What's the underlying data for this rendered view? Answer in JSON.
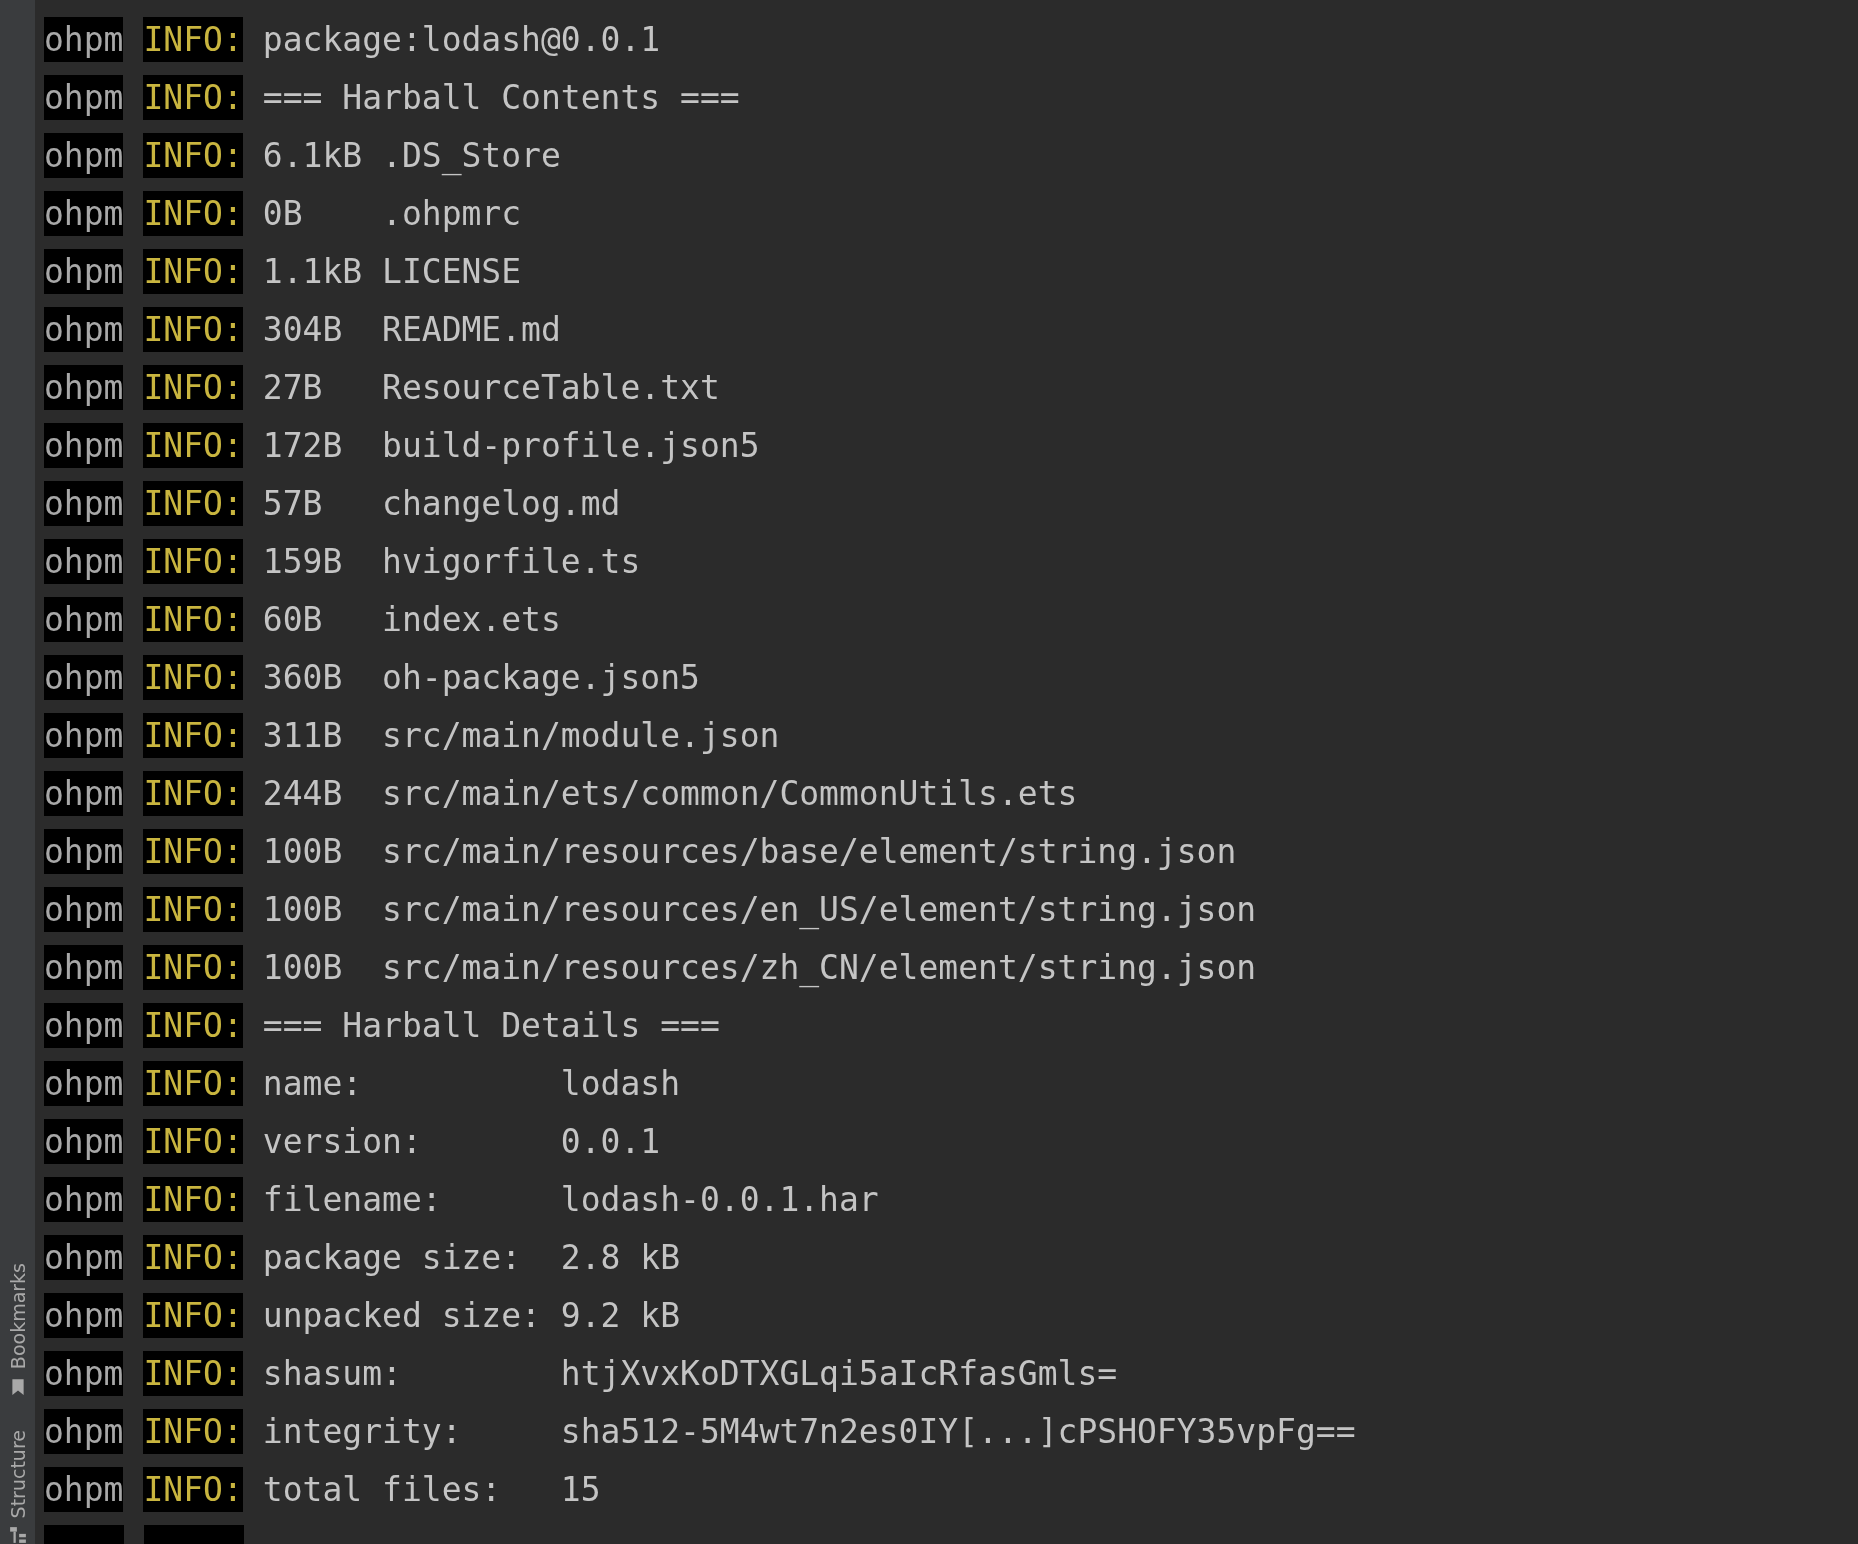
{
  "sidebar": {
    "items": [
      {
        "label": "Bookmarks",
        "kind": "bookmark"
      },
      {
        "label": "Structure",
        "kind": "structure"
      }
    ]
  },
  "log_lines": [
    {
      "source": "ohpm",
      "level": "INFO:",
      "message": "package:lodash@0.0.1"
    },
    {
      "source": "ohpm",
      "level": "INFO:",
      "message": "=== Harball Contents ==="
    },
    {
      "source": "ohpm",
      "level": "INFO:",
      "message": "6.1kB .DS_Store"
    },
    {
      "source": "ohpm",
      "level": "INFO:",
      "message": "0B    .ohpmrc"
    },
    {
      "source": "ohpm",
      "level": "INFO:",
      "message": "1.1kB LICENSE"
    },
    {
      "source": "ohpm",
      "level": "INFO:",
      "message": "304B  README.md"
    },
    {
      "source": "ohpm",
      "level": "INFO:",
      "message": "27B   ResourceTable.txt"
    },
    {
      "source": "ohpm",
      "level": "INFO:",
      "message": "172B  build-profile.json5"
    },
    {
      "source": "ohpm",
      "level": "INFO:",
      "message": "57B   changelog.md"
    },
    {
      "source": "ohpm",
      "level": "INFO:",
      "message": "159B  hvigorfile.ts"
    },
    {
      "source": "ohpm",
      "level": "INFO:",
      "message": "60B   index.ets"
    },
    {
      "source": "ohpm",
      "level": "INFO:",
      "message": "360B  oh-package.json5"
    },
    {
      "source": "ohpm",
      "level": "INFO:",
      "message": "311B  src/main/module.json"
    },
    {
      "source": "ohpm",
      "level": "INFO:",
      "message": "244B  src/main/ets/common/CommonUtils.ets"
    },
    {
      "source": "ohpm",
      "level": "INFO:",
      "message": "100B  src/main/resources/base/element/string.json"
    },
    {
      "source": "ohpm",
      "level": "INFO:",
      "message": "100B  src/main/resources/en_US/element/string.json"
    },
    {
      "source": "ohpm",
      "level": "INFO:",
      "message": "100B  src/main/resources/zh_CN/element/string.json"
    },
    {
      "source": "ohpm",
      "level": "INFO:",
      "message": "=== Harball Details ==="
    },
    {
      "source": "ohpm",
      "level": "INFO:",
      "message": "name:          lodash"
    },
    {
      "source": "ohpm",
      "level": "INFO:",
      "message": "version:       0.0.1"
    },
    {
      "source": "ohpm",
      "level": "INFO:",
      "message": "filename:      lodash-0.0.1.har"
    },
    {
      "source": "ohpm",
      "level": "INFO:",
      "message": "package size:  2.8 kB"
    },
    {
      "source": "ohpm",
      "level": "INFO:",
      "message": "unpacked size: 9.2 kB"
    },
    {
      "source": "ohpm",
      "level": "INFO:",
      "message": "shasum:        htjXvxKoDTXGLqi5aIcRfasGmls="
    },
    {
      "source": "ohpm",
      "level": "INFO:",
      "message": "integrity:     sha512-5M4wt7n2es0IY[...]cPSHOFY35vpFg=="
    },
    {
      "source": "ohpm",
      "level": "INFO:",
      "message": "total files:   15"
    },
    {
      "kind": "clipped"
    }
  ]
}
